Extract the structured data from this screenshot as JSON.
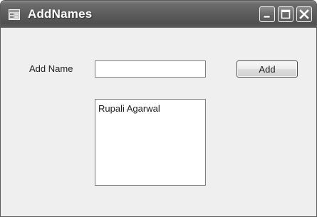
{
  "window": {
    "title": "AddNames",
    "title_icon": "app-window-icon",
    "controls": [
      {
        "name": "minimize",
        "icon": "minimize-icon"
      },
      {
        "name": "maximize",
        "icon": "maximize-icon"
      },
      {
        "name": "close",
        "icon": "close-icon"
      }
    ]
  },
  "form": {
    "add_name_label": "Add Name",
    "name_input_value": "",
    "add_button_label": "Add",
    "names_list": [
      "Rupali Agarwal"
    ]
  },
  "colors": {
    "titlebar": "#5c5c5c",
    "client_background": "#efefef",
    "control_border": "#7f7f7f"
  }
}
